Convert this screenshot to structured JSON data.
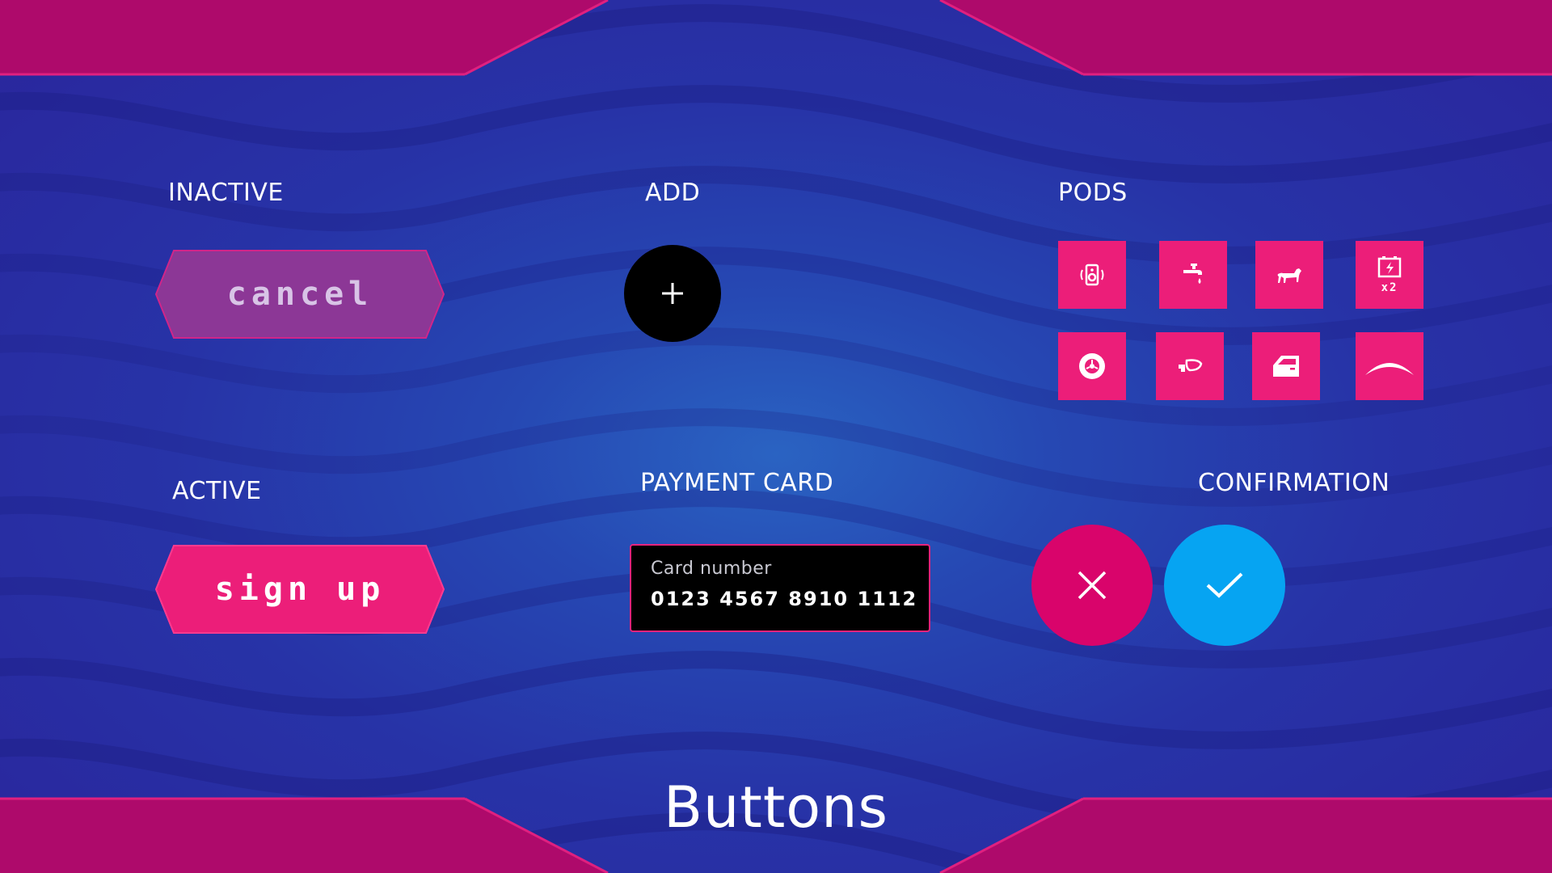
{
  "colors": {
    "background": "#2a33a6",
    "banner": "#ae0a6b",
    "accent_pink": "#ec1e79",
    "inactive_fill": "#8c3796",
    "confirm_blue": "#06a4f2",
    "reject_pink": "#d9046b"
  },
  "sections": {
    "inactive": "INACTIVE",
    "active": "ACTIVE",
    "add": "ADD",
    "payment_card": "PAYMENT CARD",
    "pods": "PODS",
    "confirmation": "CONFIRMATION"
  },
  "buttons": {
    "cancel_label": "CANCEL",
    "signup_label": "SIGN UP"
  },
  "add_button": {
    "icon": "plus-icon"
  },
  "payment_card": {
    "placeholder": "Card number",
    "value": "0123 4567 8910 1112"
  },
  "pods": {
    "items": [
      {
        "icon": "speaker-icon"
      },
      {
        "icon": "faucet-icon"
      },
      {
        "icon": "dog-icon"
      },
      {
        "icon": "battery-charge-icon",
        "badge": "x2"
      },
      {
        "icon": "wheel-icon"
      },
      {
        "icon": "side-mirror-icon"
      },
      {
        "icon": "car-door-icon"
      },
      {
        "icon": "wiper-arc-icon"
      }
    ]
  },
  "confirmation": {
    "reject_icon": "close-icon",
    "accept_icon": "checkmark-icon"
  },
  "page_title": "Buttons"
}
